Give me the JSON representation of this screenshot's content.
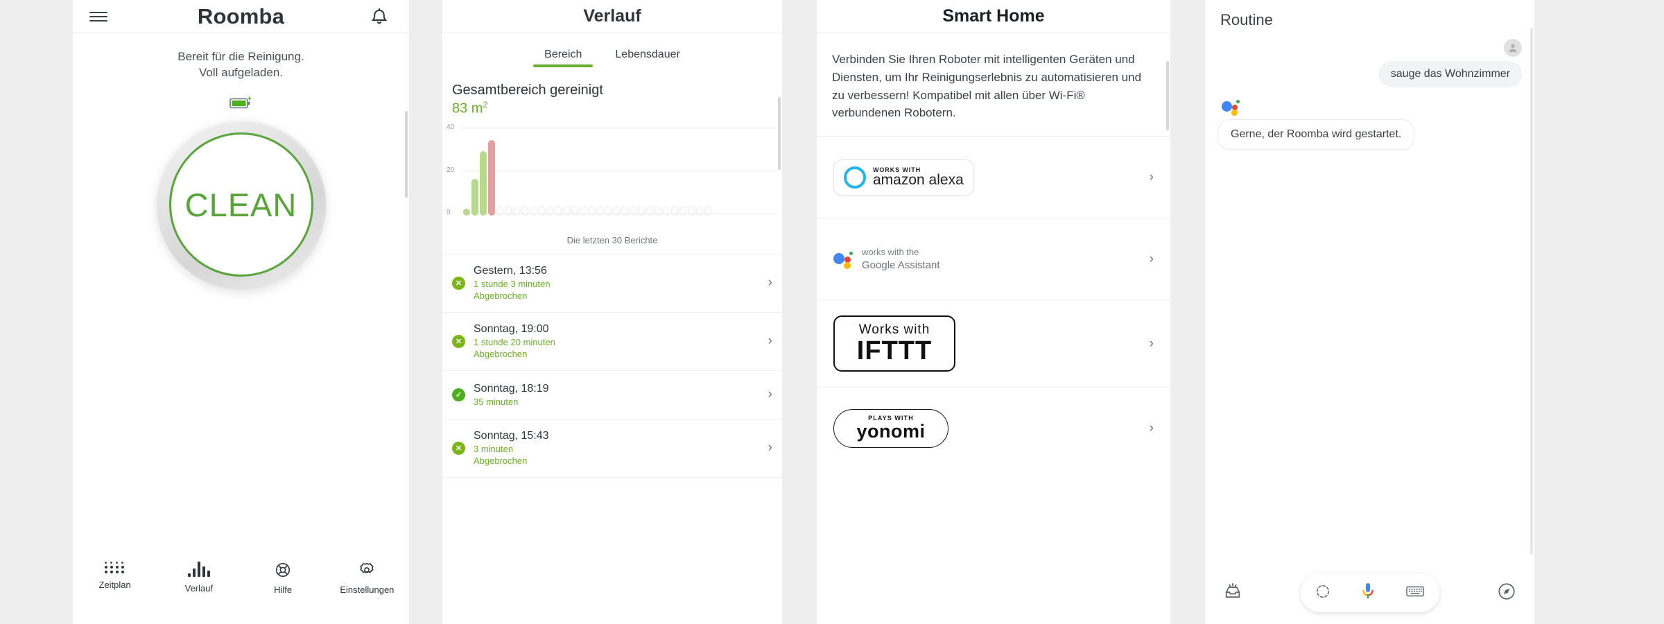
{
  "panel_roomba": {
    "title": "Roomba",
    "menu_icon": "hamburger-icon",
    "bell_icon": "bell-icon",
    "status_line1": "Bereit für die Reinigung.",
    "status_line2": "Voll aufgeladen.",
    "battery_icon": "battery-charging-icon",
    "clean_button": "CLEAN",
    "nav": [
      {
        "label": "Zeitplan",
        "icon": "schedule-dots-icon"
      },
      {
        "label": "Verlauf",
        "icon": "history-bars-icon"
      },
      {
        "label": "Hilfe",
        "icon": "help-lifebuoy-icon"
      },
      {
        "label": "Einstellungen",
        "icon": "settings-gear-icon"
      }
    ]
  },
  "panel_verlauf": {
    "title": "Verlauf",
    "tabs": [
      {
        "label": "Bereich",
        "active": true
      },
      {
        "label": "Lebensdauer",
        "active": false
      }
    ],
    "summary_label": "Gesamtbereich gereinigt",
    "summary_value": "83 m",
    "summary_unit": "2",
    "chart_caption": "Die letzten 30 Berichte",
    "history": [
      {
        "time": "Gestern, 13:56",
        "duration": "1 stunde 3 minuten",
        "state": "Abgebrochen",
        "status": "cancelled",
        "icon": "cancel-x-icon"
      },
      {
        "time": "Sonntag, 19:00",
        "duration": "1 stunde 20 minuten",
        "state": "Abgebrochen",
        "status": "cancelled",
        "icon": "cancel-x-icon"
      },
      {
        "time": "Sonntag, 18:19",
        "duration": "35 minuten",
        "state": "",
        "status": "done",
        "icon": "check-icon"
      },
      {
        "time": "Sonntag, 15:43",
        "duration": "3 minuten",
        "state": "Abgebrochen",
        "status": "cancelled",
        "icon": "cancel-x-icon"
      }
    ]
  },
  "panel_smart_home": {
    "title": "Smart Home",
    "intro": "Verbinden Sie Ihren Roboter mit intelligenten Geräten und Diensten, um Ihr Reinigungserlebnis zu automatisieren und zu verbessern! Kompatibel mit allen über Wi-Fi® verbundenen Robotern.",
    "items": [
      {
        "name": "amazon-alexa",
        "top_text": "WORKS WITH",
        "main_text": "amazon alexa",
        "chevron": "chevron-right-icon"
      },
      {
        "name": "google-assistant",
        "top_text": "works with the",
        "main_text": "Google Assistant",
        "chevron": "chevron-right-icon"
      },
      {
        "name": "ifttt",
        "top_text": "Works with",
        "main_text": "IFTTT",
        "chevron": "chevron-right-icon"
      },
      {
        "name": "yonomi",
        "top_text": "PLAYS WITH",
        "main_text": "yonomi",
        "chevron": "chevron-right-icon"
      }
    ]
  },
  "panel_routine": {
    "title": "Routine",
    "user_message": "sauge das Wohnzimmer",
    "assistant_message": "Gerne, der Roomba wird gestartet.",
    "avatar_icon": "user-avatar-icon",
    "assistant_icon": "google-assistant-dots-icon",
    "bottom_bar": {
      "left_icon": "inbox-updates-icon",
      "lens_icon": "google-lens-icon",
      "mic_icon": "microphone-icon",
      "keyboard_icon": "keyboard-icon",
      "right_icon": "explore-compass-icon"
    }
  },
  "colors": {
    "brand_green": "#5aa43c",
    "accent_green": "#6aae2b",
    "bar_green": "#b7d88e",
    "bar_red": "#e2a0a0",
    "text_dark": "#2f343a",
    "google_blue": "#4285f4",
    "google_red": "#ea4335",
    "google_yellow": "#fbbc05",
    "google_green": "#34a853",
    "alexa_blue": "#23b5e8"
  },
  "chart_data": {
    "type": "bar",
    "title": "Gesamtbereich gereinigt",
    "xlabel": "Die letzten 30 Berichte",
    "ylabel": "",
    "ylim": [
      0,
      40
    ],
    "yticks": [
      0,
      20,
      40
    ],
    "grid": true,
    "legend": "none",
    "categories": [
      "1",
      "2",
      "3",
      "4",
      "5",
      "6",
      "7",
      "8",
      "9",
      "10",
      "11",
      "12",
      "13",
      "14",
      "15",
      "16",
      "17",
      "18",
      "19",
      "20",
      "21",
      "22",
      "23",
      "24",
      "25",
      "26",
      "27",
      "28",
      "29",
      "30"
    ],
    "values": [
      1,
      17,
      30,
      35,
      0,
      0,
      0,
      0,
      0,
      0,
      0,
      0,
      0,
      0,
      0,
      0,
      0,
      0,
      0,
      0,
      0,
      0,
      0,
      0,
      0,
      0,
      0,
      0,
      0,
      0
    ],
    "bar_colors": [
      "#b7d88e",
      "#b7d88e",
      "#b7d88e",
      "#e2a0a0",
      "empty",
      "empty",
      "empty",
      "empty",
      "empty",
      "empty",
      "empty",
      "empty",
      "empty",
      "empty",
      "empty",
      "empty",
      "empty",
      "empty",
      "empty",
      "empty",
      "empty",
      "empty",
      "empty",
      "empty",
      "empty",
      "empty",
      "empty",
      "empty",
      "empty",
      "empty"
    ]
  }
}
